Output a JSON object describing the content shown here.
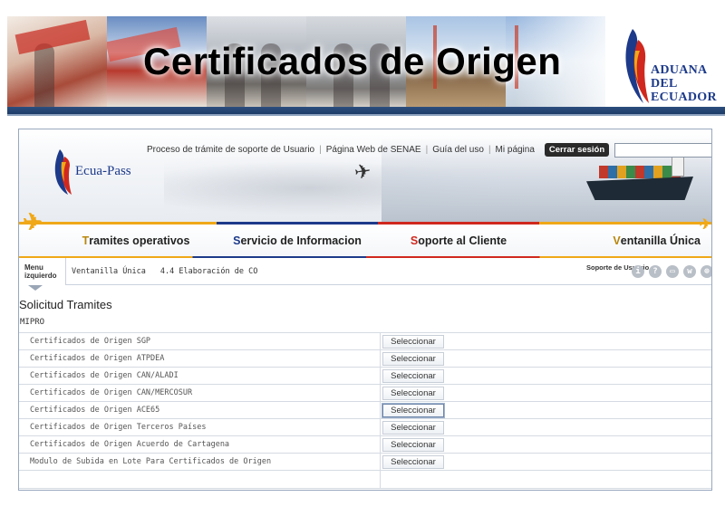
{
  "slide": {
    "title": "Certificados de Origen",
    "aduana_logo": [
      "ADUANA",
      "DEL",
      "ECUADOR"
    ]
  },
  "header": {
    "logo_text": "Ecua-Pass",
    "links": [
      "Proceso de trámite de soporte de Usuario",
      "Página Web de SENAE",
      "Guía del uso",
      "Mi página"
    ],
    "logout_label": "Cerrar sesión",
    "search_value": ""
  },
  "nav": {
    "items": [
      {
        "cap": "T",
        "rest": "ramites operativos"
      },
      {
        "cap": "S",
        "rest": "ervicio de Informacion"
      },
      {
        "cap": "S",
        "rest": "oporte al Cliente"
      },
      {
        "cap": "V",
        "rest": "entanilla Única"
      }
    ]
  },
  "breadcrumb": {
    "menu_tab": "Menu izquierdo",
    "items": [
      "Ventanilla Única",
      "4.4 Elaboración de CO"
    ],
    "support_label": "Soporte de Usuario",
    "tool_icons": [
      "info-icon",
      "help-icon",
      "print-icon",
      "window-icon",
      "globe-icon"
    ]
  },
  "content": {
    "section_title": "Solicitud Tramites",
    "group_label": "MIPRO",
    "button_label": "Seleccionar",
    "rows": [
      "Certificados de Origen SGP",
      "Certificados de Origen ATPDEA",
      "Certificados de Origen CAN/ALADI",
      "Certificados de Origen CAN/MERCOSUR",
      "Certificados de Origen ACE65",
      "Certificados de Origen Terceros Países",
      "Certificados de Origen Acuerdo de Cartagena",
      "Modulo de Subida en Lote Para Certificados de Origen"
    ],
    "active_row_index": 4
  },
  "colors": {
    "brand_blue": "#1d3a8a",
    "brand_yellow": "#f0a818",
    "brand_red": "#d0281e"
  }
}
